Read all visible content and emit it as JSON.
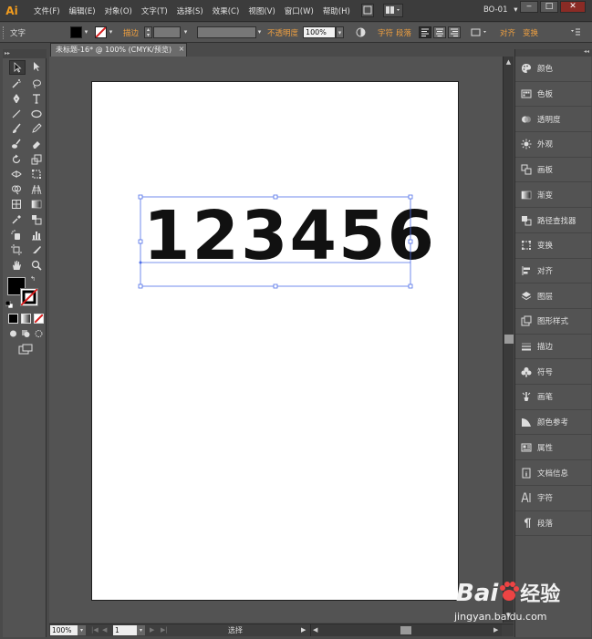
{
  "app": {
    "logo": "Ai",
    "workspace": "BO-01",
    "workspace_arrow": "▾"
  },
  "window_controls": {
    "minimize": "‒",
    "maximize": "□",
    "close": "✕"
  },
  "menus": [
    "文件(F)",
    "编辑(E)",
    "对象(O)",
    "文字(T)",
    "选择(S)",
    "效果(C)",
    "视图(V)",
    "窗口(W)",
    "帮助(H)"
  ],
  "control_bar": {
    "section_label": "文字",
    "stroke_label": "描边",
    "opacity_label": "不透明度",
    "opacity_value": "100%",
    "char_label": "字符",
    "para_label": "段落",
    "align_label": "对齐",
    "transform_label": "变换",
    "fill_color": "#000000",
    "stroke_color": "#ffffff",
    "accent_color": "#f0a040"
  },
  "document": {
    "tab_title": "未标题-16* @ 100% (CMYK/预览)",
    "close_glyph": "×",
    "artboard_text": "123456"
  },
  "status_bar": {
    "zoom": "100%",
    "artboard_number": "1",
    "status_text": "选择"
  },
  "right_panels": [
    {
      "label": "颜色",
      "icon": "palette-icon"
    },
    {
      "label": "色板",
      "icon": "swatches-icon"
    },
    {
      "label": "透明度",
      "icon": "transparency-icon"
    },
    {
      "label": "外观",
      "icon": "appearance-icon"
    },
    {
      "label": "画板",
      "icon": "artboards-icon"
    },
    {
      "label": "渐变",
      "icon": "gradient-icon"
    },
    {
      "label": "路径查找器",
      "icon": "pathfinder-icon"
    },
    {
      "label": "变换",
      "icon": "transform-icon"
    },
    {
      "label": "对齐",
      "icon": "align-icon"
    },
    {
      "label": "图层",
      "icon": "layers-icon"
    },
    {
      "label": "图形样式",
      "icon": "graphic-styles-icon"
    },
    {
      "label": "描边",
      "icon": "stroke-icon"
    },
    {
      "label": "符号",
      "icon": "symbols-icon"
    },
    {
      "label": "画笔",
      "icon": "brushes-icon"
    },
    {
      "label": "颜色参考",
      "icon": "color-guide-icon"
    },
    {
      "label": "属性",
      "icon": "attributes-icon"
    },
    {
      "label": "文档信息",
      "icon": "document-info-icon"
    },
    {
      "label": "字符",
      "icon": "character-icon"
    },
    {
      "label": "段落",
      "icon": "paragraph-icon"
    }
  ],
  "watermark": {
    "brand": "Bai",
    "brand_cn": "经验",
    "url": "jingyan.baidu.com"
  }
}
